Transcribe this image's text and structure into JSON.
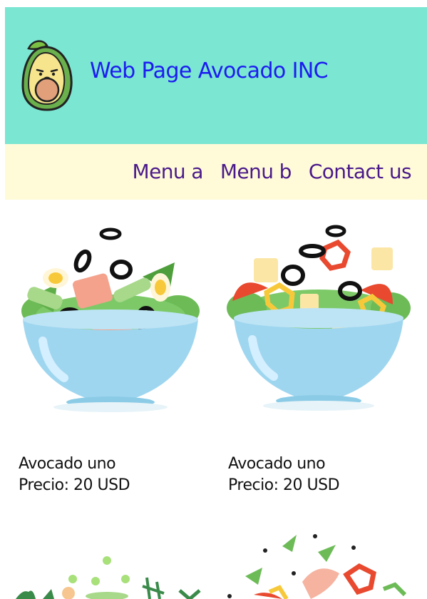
{
  "header": {
    "title": "Web Page Avocado INC",
    "logo_icon": "avocado-logo-icon",
    "background": "#7be6d2",
    "title_color": "#1c1cf0"
  },
  "nav": {
    "background": "#fffbd9",
    "items": [
      {
        "label": "Menu a"
      },
      {
        "label": "Menu b"
      },
      {
        "label": "Contact us"
      }
    ]
  },
  "products": [
    {
      "name": "Avocado uno",
      "price": "Precio: 20 USD",
      "image_icon": "salad-bowl-olives-salmon-icon"
    },
    {
      "name": "Avocado uno",
      "price": "Precio: 20 USD",
      "image_icon": "salad-bowl-peppers-cheese-icon"
    },
    {
      "name": "",
      "price": "",
      "image_icon": "salad-bowl-herbs-icon"
    },
    {
      "name": "",
      "price": "",
      "image_icon": "salad-bowl-shrimp-icon"
    }
  ]
}
